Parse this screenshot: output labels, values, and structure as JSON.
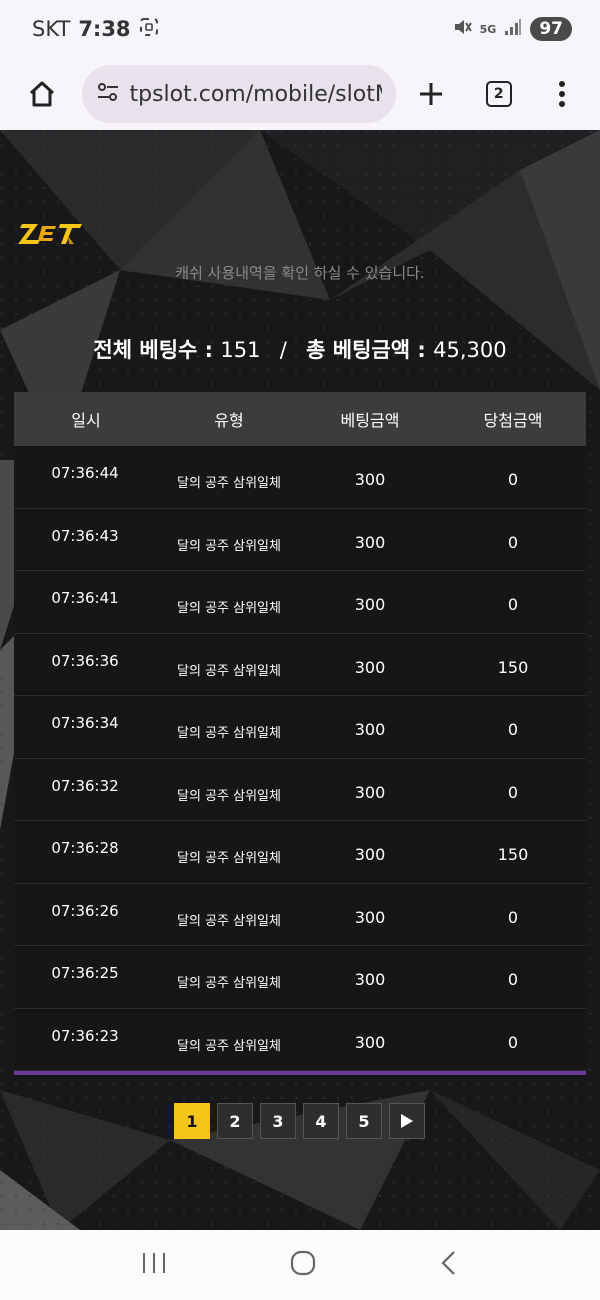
{
  "status_bar": {
    "carrier": "SKT",
    "time": "7:38",
    "network": "5G",
    "battery": "97"
  },
  "browser": {
    "url": "tpslot.com/mobile/slotM",
    "tab_count": "2"
  },
  "page": {
    "description": "캐쉬 사용내역을 확인 하실 수 있습니다.",
    "summary": {
      "total_bets_label": "전체 베팅수 : ",
      "total_bets_value": "151",
      "separator": "/",
      "total_amount_label": "총 베팅금액 : ",
      "total_amount_value": "45,300"
    },
    "table": {
      "headers": [
        "일시",
        "유형",
        "베팅금액",
        "당첨금액"
      ],
      "rows": [
        [
          "07:36:44",
          "달의 공주 삼위일체",
          "300",
          "0"
        ],
        [
          "07:36:43",
          "달의 공주 삼위일체",
          "300",
          "0"
        ],
        [
          "07:36:41",
          "달의 공주 삼위일체",
          "300",
          "0"
        ],
        [
          "07:36:36",
          "달의 공주 삼위일체",
          "300",
          "150"
        ],
        [
          "07:36:34",
          "달의 공주 삼위일체",
          "300",
          "0"
        ],
        [
          "07:36:32",
          "달의 공주 삼위일체",
          "300",
          "0"
        ],
        [
          "07:36:28",
          "달의 공주 삼위일체",
          "300",
          "150"
        ],
        [
          "07:36:26",
          "달의 공주 삼위일체",
          "300",
          "0"
        ],
        [
          "07:36:25",
          "달의 공주 삼위일체",
          "300",
          "0"
        ],
        [
          "07:36:23",
          "달의 공주 삼위일체",
          "300",
          "0"
        ]
      ]
    },
    "pagination": {
      "pages": [
        "1",
        "2",
        "3",
        "4",
        "5"
      ],
      "current": "1",
      "next_icon": "play-next-icon"
    }
  },
  "colors": {
    "accent": "#f5c518",
    "table_bottom": "#6a3b96",
    "header_bg": "#3c3c3e"
  }
}
